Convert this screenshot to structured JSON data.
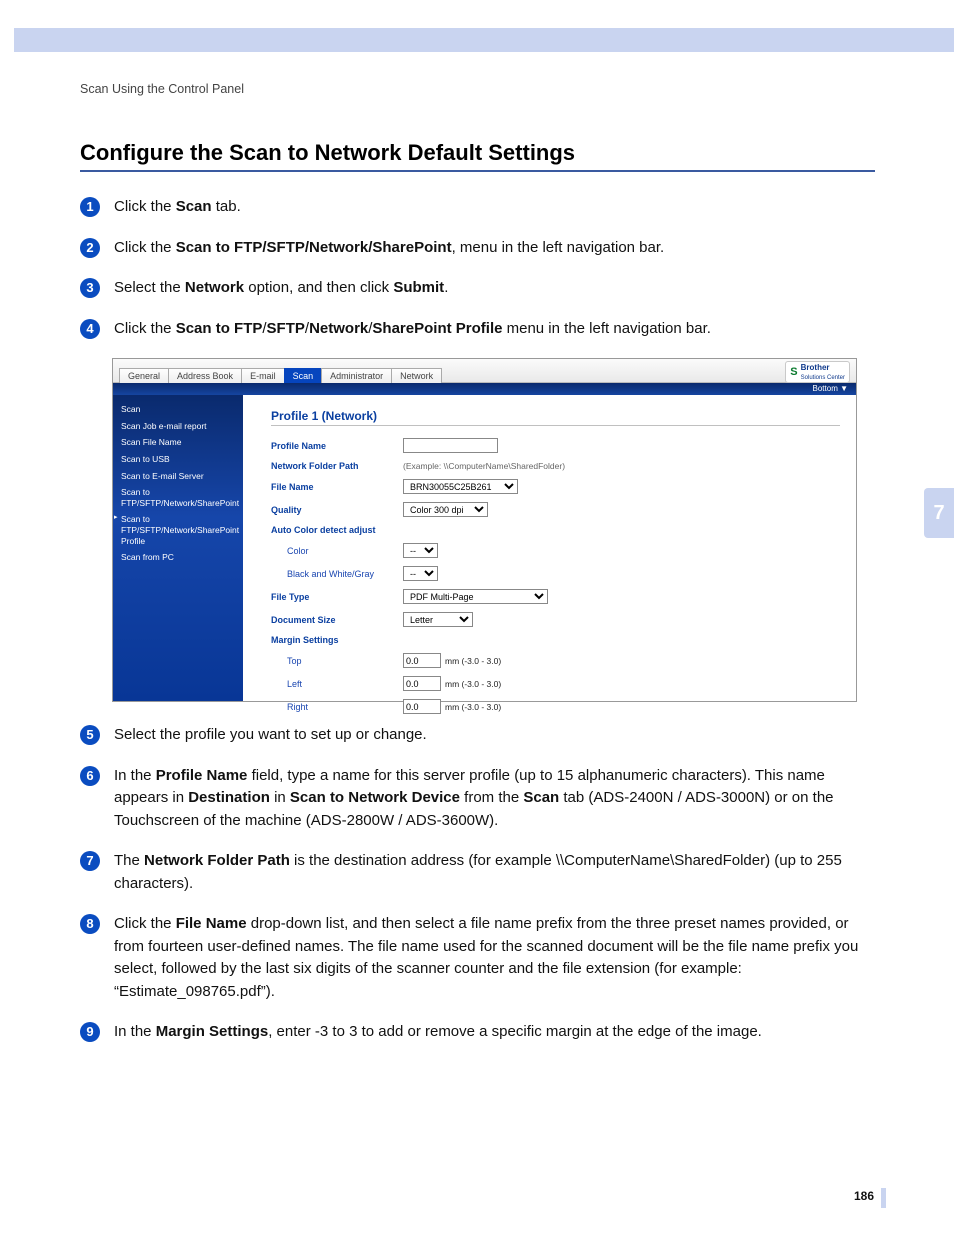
{
  "header_crumb": "Scan Using the Control Panel",
  "title": "Configure the Scan to Network Default Settings",
  "chapter": "7",
  "page_number": "186",
  "steps": {
    "s1": {
      "pre": "Click the ",
      "b1": "Scan",
      "post": " tab."
    },
    "s2": {
      "pre": "Click the ",
      "b1": "Scan to FTP/SFTP/Network/SharePoint",
      "post": ", menu in the left navigation bar."
    },
    "s3": {
      "pre": "Select the ",
      "b1": "Network",
      "mid": " option, and then click ",
      "b2": "Submit",
      "post": "."
    },
    "s4": {
      "pre": "Click the ",
      "b1": "Scan to FTP",
      "sep": "/",
      "b2": "SFTP",
      "b3": "Network",
      "b4": "SharePoint Profile",
      "post": " menu in the left navigation bar."
    },
    "s5": "Select the profile you want to set up or change.",
    "s6": {
      "p1a": "In the ",
      "p1b": "Profile Name",
      "p1c": " field, type a name for this server profile (up to 15 alphanumeric characters). This name appears in ",
      "p1d": "Destination",
      "p1e": " in ",
      "p1f": "Scan to Network Device",
      "p1g": " from the ",
      "p1h": "Scan",
      "p1i": " tab (ADS-2400N / ADS-3000N) or on the Touchscreen of the machine (ADS-2800W / ADS-3600W)."
    },
    "s7": {
      "a": "The ",
      "b": "Network Folder Path",
      "c": " is the destination address (for example \\\\ComputerName\\SharedFolder) (up to 255 characters)."
    },
    "s8": {
      "a": "Click the ",
      "b": "File Name",
      "c": " drop-down list, and then select a file name prefix from the three preset names provided, or from fourteen user-defined names. The file name used for the scanned document will be the file name prefix you select, followed by the last six digits of the scanner counter and the file extension (for example: “Estimate_098765.pdf”)."
    },
    "s9": {
      "a": "In the ",
      "b": "Margin Settings",
      "c": ", enter -3 to 3 to add or remove a specific margin at the edge of the image."
    }
  },
  "panel": {
    "tabs": [
      "General",
      "Address Book",
      "E-mail",
      "Scan",
      "Administrator",
      "Network"
    ],
    "active_tab": "Scan",
    "logo_text": "Brother",
    "logo_sub": "Solutions Center",
    "bottom_link": "Bottom ▼",
    "sidenav": [
      "Scan",
      "Scan Job e-mail report",
      "Scan File Name",
      "Scan to USB",
      "Scan to E-mail Server",
      "Scan to FTP/SFTP/Network/SharePoint",
      "Scan to FTP/SFTP/Network/SharePoint Profile",
      "Scan from PC"
    ],
    "sidenav_active_index": 6,
    "form_title": "Profile 1 (Network)",
    "fields": {
      "profile_name_label": "Profile Name",
      "profile_name_value": "",
      "nfp_label": "Network Folder Path",
      "nfp_hint": "(Example: \\\\ComputerName\\SharedFolder)",
      "file_name_label": "File Name",
      "file_name_value": "BRN30055C25B261",
      "quality_label": "Quality",
      "quality_value": "Color 300 dpi",
      "auto_color_label": "Auto Color detect adjust",
      "auto_color_sub_color": "Color",
      "auto_color_sub_bw": "Black and White/Gray",
      "auto_color_value": "--",
      "file_type_label": "File Type",
      "file_type_value": "PDF Multi-Page",
      "doc_size_label": "Document Size",
      "doc_size_value": "Letter",
      "margin_label": "Margin Settings",
      "margin_top": "Top",
      "margin_left": "Left",
      "margin_right": "Right",
      "margin_value": "0.0",
      "margin_unit": "mm (-3.0 - 3.0)"
    }
  }
}
